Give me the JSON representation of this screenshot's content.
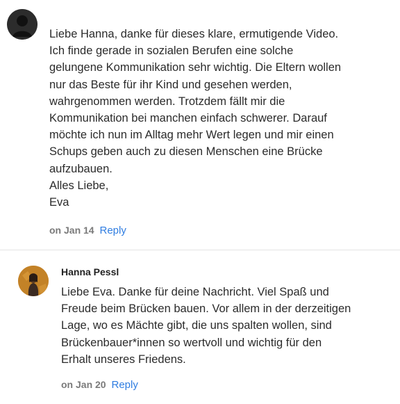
{
  "comments": [
    {
      "author": "",
      "avatar_icon": "default-user-avatar-icon",
      "lines": [
        "Liebe Hanna, danke für dieses klare, ermutigende Video.",
        "Ich finde gerade in sozialen Berufen eine solche",
        "gelungene Kommunikation sehr wichtig. Die Eltern wollen",
        "nur das Beste für ihr Kind und gesehen werden,",
        "wahrgenommen werden. Trotzdem fällt mir die",
        "Kommunikation bei manchen einfach schwerer. Darauf",
        "möchte ich nun im Alltag mehr Wert legen und mir einen",
        "Schups geben auch zu diesen Menschen eine Brücke",
        "aufzubauen.",
        "Alles Liebe,",
        "Eva"
      ],
      "date": "on Jan 14",
      "reply_label": "Reply"
    },
    {
      "author": "Hanna Pessl",
      "avatar_icon": "profile-photo-avatar",
      "lines": [
        "Liebe Eva. Danke für deine Nachricht. Viel Spaß und",
        "Freude beim Brücken bauen. Vor allem in der derzeitigen",
        "Lage, wo es Mächte gibt, die uns spalten wollen, sind",
        "Brückenbauer*innen so wertvoll und wichtig für den",
        "Erhalt unseres Friedens."
      ],
      "date": "on Jan 20",
      "reply_label": "Reply"
    }
  ],
  "colors": {
    "reply_link": "#2f7de1",
    "date_text": "#7a7a7a",
    "divider": "#e3e3e3"
  }
}
